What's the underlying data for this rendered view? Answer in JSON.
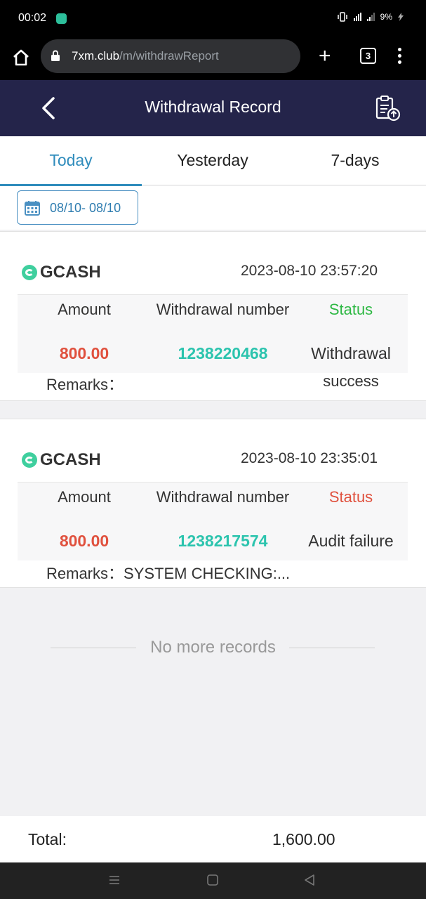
{
  "status_bar": {
    "time": "00:02",
    "battery": "9%"
  },
  "browser": {
    "url_host": "7xm.club",
    "url_path": "/m/withdrawReport",
    "tab_count": "3"
  },
  "header": {
    "title": "Withdrawal Record"
  },
  "tabs": [
    {
      "label": "Today",
      "active": true
    },
    {
      "label": "Yesterday",
      "active": false
    },
    {
      "label": "7-days",
      "active": false
    }
  ],
  "date_range": "08/10- 08/10",
  "columns": {
    "amount": "Amount",
    "number": "Withdrawal number",
    "status": "Status",
    "remarks": "Remarks："
  },
  "records": [
    {
      "method": "GCASH",
      "datetime": "2023-08-10 23:57:20",
      "amount": "800.00",
      "number": "1238220468",
      "status_line1": "Withdrawal",
      "status_line2": "success",
      "remarks": "",
      "status_color": "#2eb844"
    },
    {
      "method": "GCASH",
      "datetime": "2023-08-10 23:35:01",
      "amount": "800.00",
      "number": "1238217574",
      "status_line1": "Audit failure",
      "status_line2": "",
      "remarks": "SYSTEM CHECKING:...",
      "status_color": "#e0513e"
    }
  ],
  "no_more": "No more records",
  "total": {
    "label": "Total:",
    "value": "1,600.00"
  },
  "colors": {
    "header_bg": "#24244a",
    "accent": "#2f8cbc",
    "amount": "#e0513e",
    "number": "#2cc4ae"
  }
}
